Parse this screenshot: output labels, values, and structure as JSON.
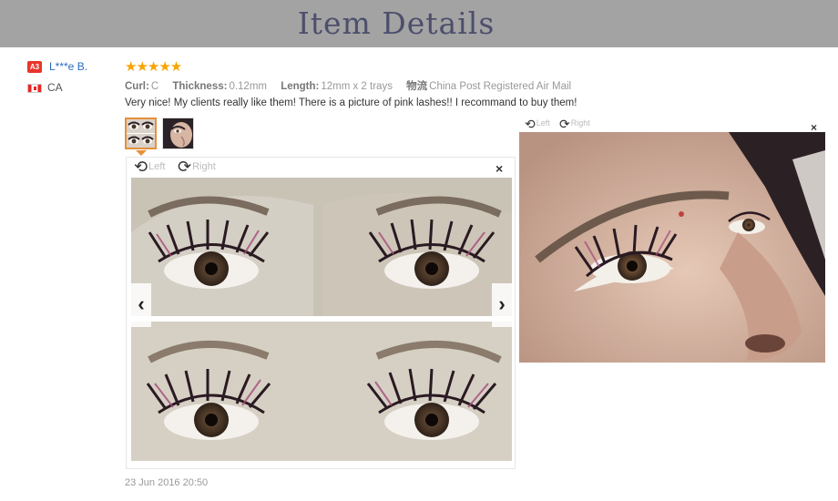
{
  "header": {
    "title": "Item  Details"
  },
  "reviewer": {
    "badge": "A3",
    "name": "L***e B.",
    "country": "CA"
  },
  "review": {
    "stars": "★★★★★",
    "attributes": [
      {
        "label": "Curl:",
        "value": "C"
      },
      {
        "label": "Thickness:",
        "value": "0.12mm"
      },
      {
        "label": "Length:",
        "value": "12mm x 2 trays"
      },
      {
        "label": "物流",
        "value": "China Post Registered Air Mail"
      }
    ],
    "comment": "Very nice! My clients really like them! There is a picture of pink lashes!! I recommand to buy them!",
    "date": "23 Jun 2016 20:50"
  },
  "viewer": {
    "rotate_left": "Left",
    "rotate_right": "Right",
    "close": "×",
    "prev": "‹",
    "next": "›"
  },
  "viewer2": {
    "rotate_left": "Left",
    "rotate_right": "Right",
    "close": "×"
  },
  "colors": {
    "star": "#f7a400",
    "link": "#2a6cbf",
    "badge": "#e8362a",
    "header_bg": "#a3a3a3",
    "title": "#4c4f6c"
  }
}
